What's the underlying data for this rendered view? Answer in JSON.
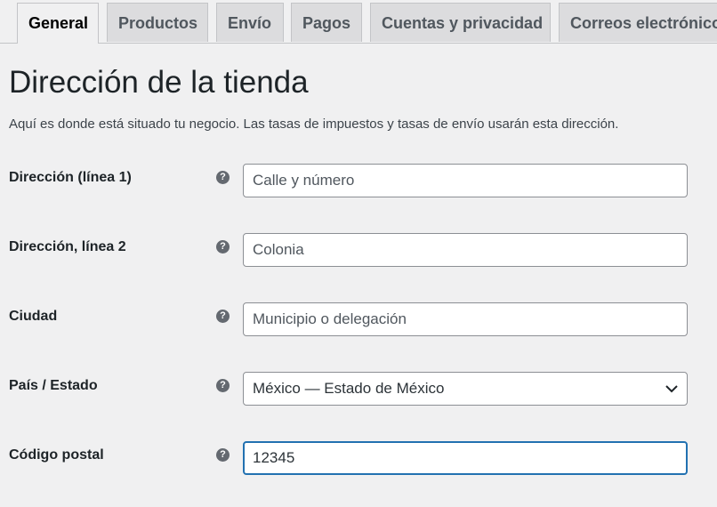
{
  "tabs": [
    {
      "label": "General",
      "active": true
    },
    {
      "label": "Productos"
    },
    {
      "label": "Envío"
    },
    {
      "label": "Pagos"
    },
    {
      "label": "Cuentas y privacidad"
    },
    {
      "label": "Correos electrónicos"
    }
  ],
  "section": {
    "title": "Dirección de la tienda",
    "description": "Aquí es donde está situado tu negocio. Las tasas de impuestos y tasas de envío usarán esta dirección."
  },
  "fields": {
    "address1": {
      "label": "Dirección (línea 1)",
      "placeholder": "Calle y número",
      "value": ""
    },
    "address2": {
      "label": "Dirección, línea 2",
      "placeholder": "Colonia",
      "value": ""
    },
    "city": {
      "label": "Ciudad",
      "placeholder": "Municipio o delegación",
      "value": ""
    },
    "country": {
      "label": "País / Estado",
      "selected": "México — Estado de México"
    },
    "postcode": {
      "label": "Código postal",
      "value": "12345"
    }
  },
  "help_glyph": "?",
  "icons": {
    "help": "question-circle-icon",
    "select": "chevron-down-icon"
  },
  "colors": {
    "focus": "#2271b1",
    "help": "#646970",
    "background": "#f0f0f1"
  }
}
